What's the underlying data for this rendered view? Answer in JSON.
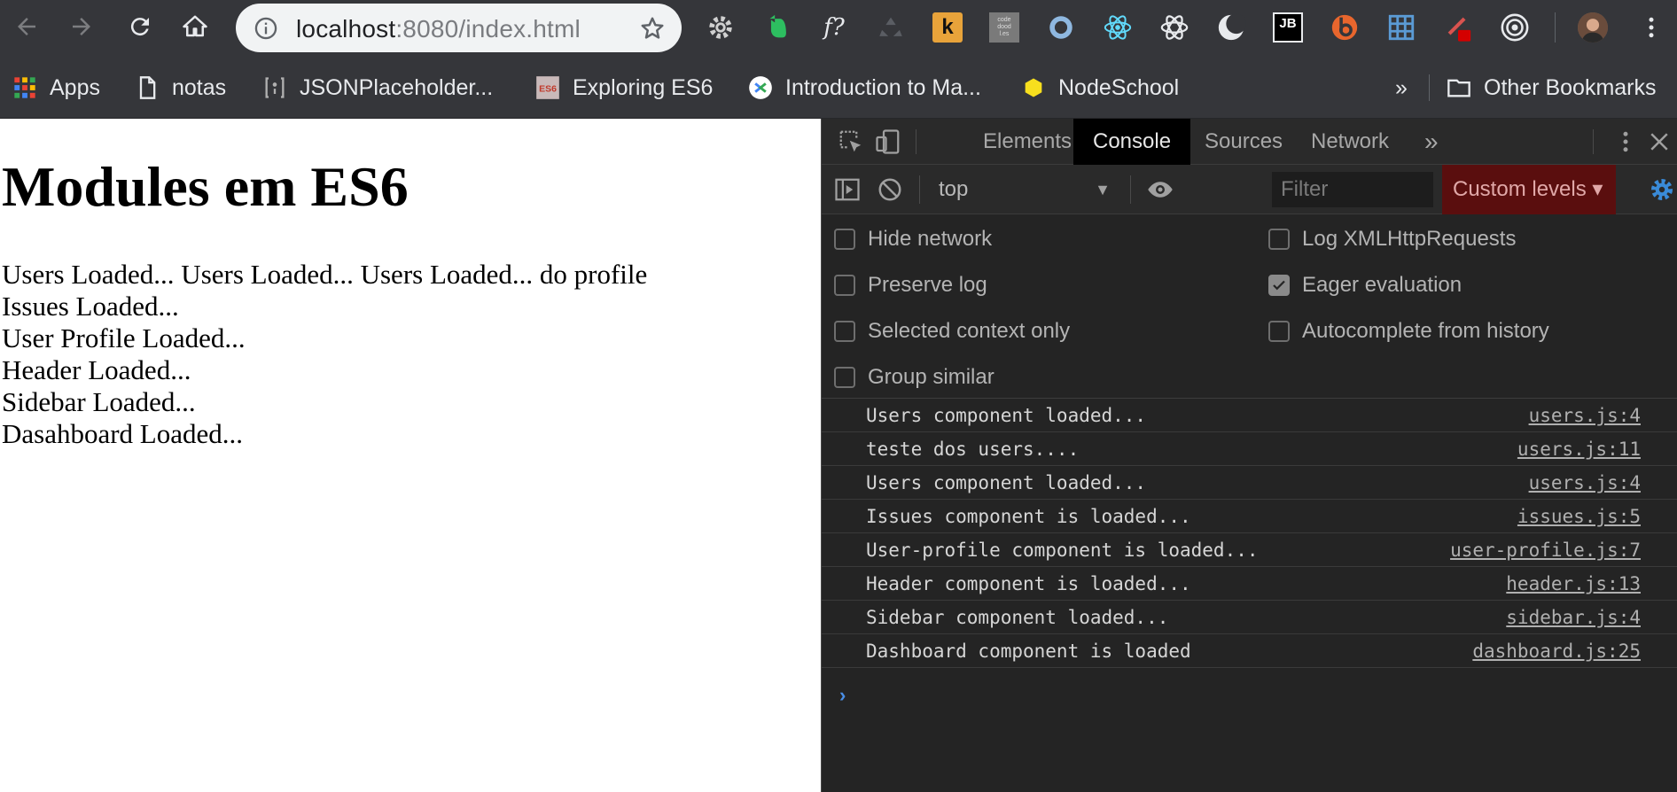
{
  "browser": {
    "url_host": "localhost",
    "url_rest": ":8080/index.html",
    "extensions": [
      "gear-extension",
      "evernote-extension",
      "function-extension",
      "recycle-extension",
      "k-extension",
      "codedoodl-extension",
      "circle-extension",
      "react-devtools-extension",
      "atom-extension",
      "moon-extension",
      "jetbrains-extension",
      "b-extension",
      "grid-extension",
      "paint-extension",
      "target-extension",
      "profile-avatar"
    ],
    "ext_labels": {
      "k": "k",
      "jb": "JB",
      "codedoodl": "code\ndood\nl.es",
      "fq": "f?"
    }
  },
  "bookmarks": {
    "items": [
      {
        "label": "Apps",
        "icon": "apps-grid-icon"
      },
      {
        "label": "notas",
        "icon": "page-icon"
      },
      {
        "label": "JSONPlaceholder...",
        "icon": "json-icon"
      },
      {
        "label": "Exploring ES6",
        "icon": "es6-icon"
      },
      {
        "label": "Introduction to Ma...",
        "icon": "google-icon"
      },
      {
        "label": "NodeSchool",
        "icon": "hexagon-icon"
      }
    ],
    "overflow": "»",
    "other_label": "Other Bookmarks"
  },
  "page": {
    "title": "Modules em ES6",
    "lines": [
      "Users Loaded... Users Loaded... Users Loaded... do profile",
      "Issues Loaded...",
      "User Profile Loaded...",
      "Header Loaded...",
      "Sidebar Loaded...",
      "Dasahboard Loaded..."
    ]
  },
  "devtools": {
    "tabs": [
      {
        "label": "Elements",
        "active": false
      },
      {
        "label": "Console",
        "active": true
      },
      {
        "label": "Sources",
        "active": false
      },
      {
        "label": "Network",
        "active": false
      }
    ],
    "more_tabs": "»",
    "context": "top",
    "filter_placeholder": "Filter",
    "levels_label": "Custom levels ▾",
    "settings_left": [
      {
        "label": "Hide network",
        "checked": false
      },
      {
        "label": "Preserve log",
        "checked": false
      },
      {
        "label": "Selected context only",
        "checked": false
      },
      {
        "label": "Group similar",
        "checked": false
      }
    ],
    "settings_right": [
      {
        "label": "Log XMLHttpRequests",
        "checked": false
      },
      {
        "label": "Eager evaluation",
        "checked": true
      },
      {
        "label": "Autocomplete from history",
        "checked": false
      }
    ],
    "messages": [
      {
        "text": "Users component loaded...",
        "source": "users.js:4"
      },
      {
        "text": "teste dos users....",
        "source": "users.js:11"
      },
      {
        "text": "Users component loaded...",
        "source": "users.js:4"
      },
      {
        "text": "Issues component is loaded...",
        "source": "issues.js:5"
      },
      {
        "text": "User-profile component is loaded...",
        "source": "user-profile.js:7"
      },
      {
        "text": "Header component is loaded...",
        "source": "header.js:13"
      },
      {
        "text": "Sidebar component loaded...",
        "source": "sidebar.js:4"
      },
      {
        "text": "Dashboard component is loaded",
        "source": "dashboard.js:25"
      }
    ],
    "prompt": "›"
  },
  "colors": {
    "accent_blue": "#4a8fe7",
    "levels_bg": "#5a0e0e",
    "toolbar": "#35363a",
    "devtools_bg": "#242424"
  }
}
